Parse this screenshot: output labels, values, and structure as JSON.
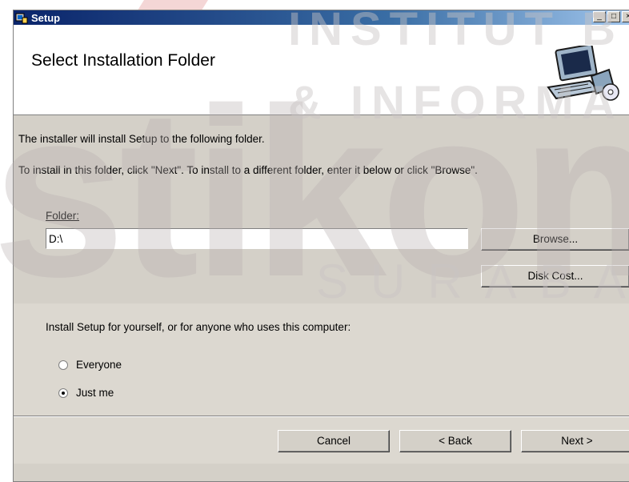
{
  "window": {
    "title": "Setup",
    "controls": [
      "_",
      "□",
      "×"
    ]
  },
  "banner": {
    "title": "Select Installation Folder",
    "icon": "computer-icon"
  },
  "body": {
    "line1": "The installer will install Setup to the following folder.",
    "line2": "To install in this folder, click \"Next\". To install to a different folder, enter it below or click \"Browse\".",
    "folder_label": "Folder:",
    "folder_value": "D:\\",
    "browse_label": "Browse...",
    "disk_cost_label": "Disk Cost..."
  },
  "install_for": {
    "label": "Install Setup for yourself, or for anyone who uses this computer:",
    "options": [
      {
        "label": "Everyone",
        "selected": false
      },
      {
        "label": "Just me",
        "selected": true
      }
    ]
  },
  "buttons": {
    "cancel": "Cancel",
    "back": "< Back",
    "next": "Next >"
  },
  "watermark": {
    "big": "stikom",
    "line1": "INSTITUT B",
    "line2": "& INFORMA",
    "line3": "SURABAYA"
  }
}
